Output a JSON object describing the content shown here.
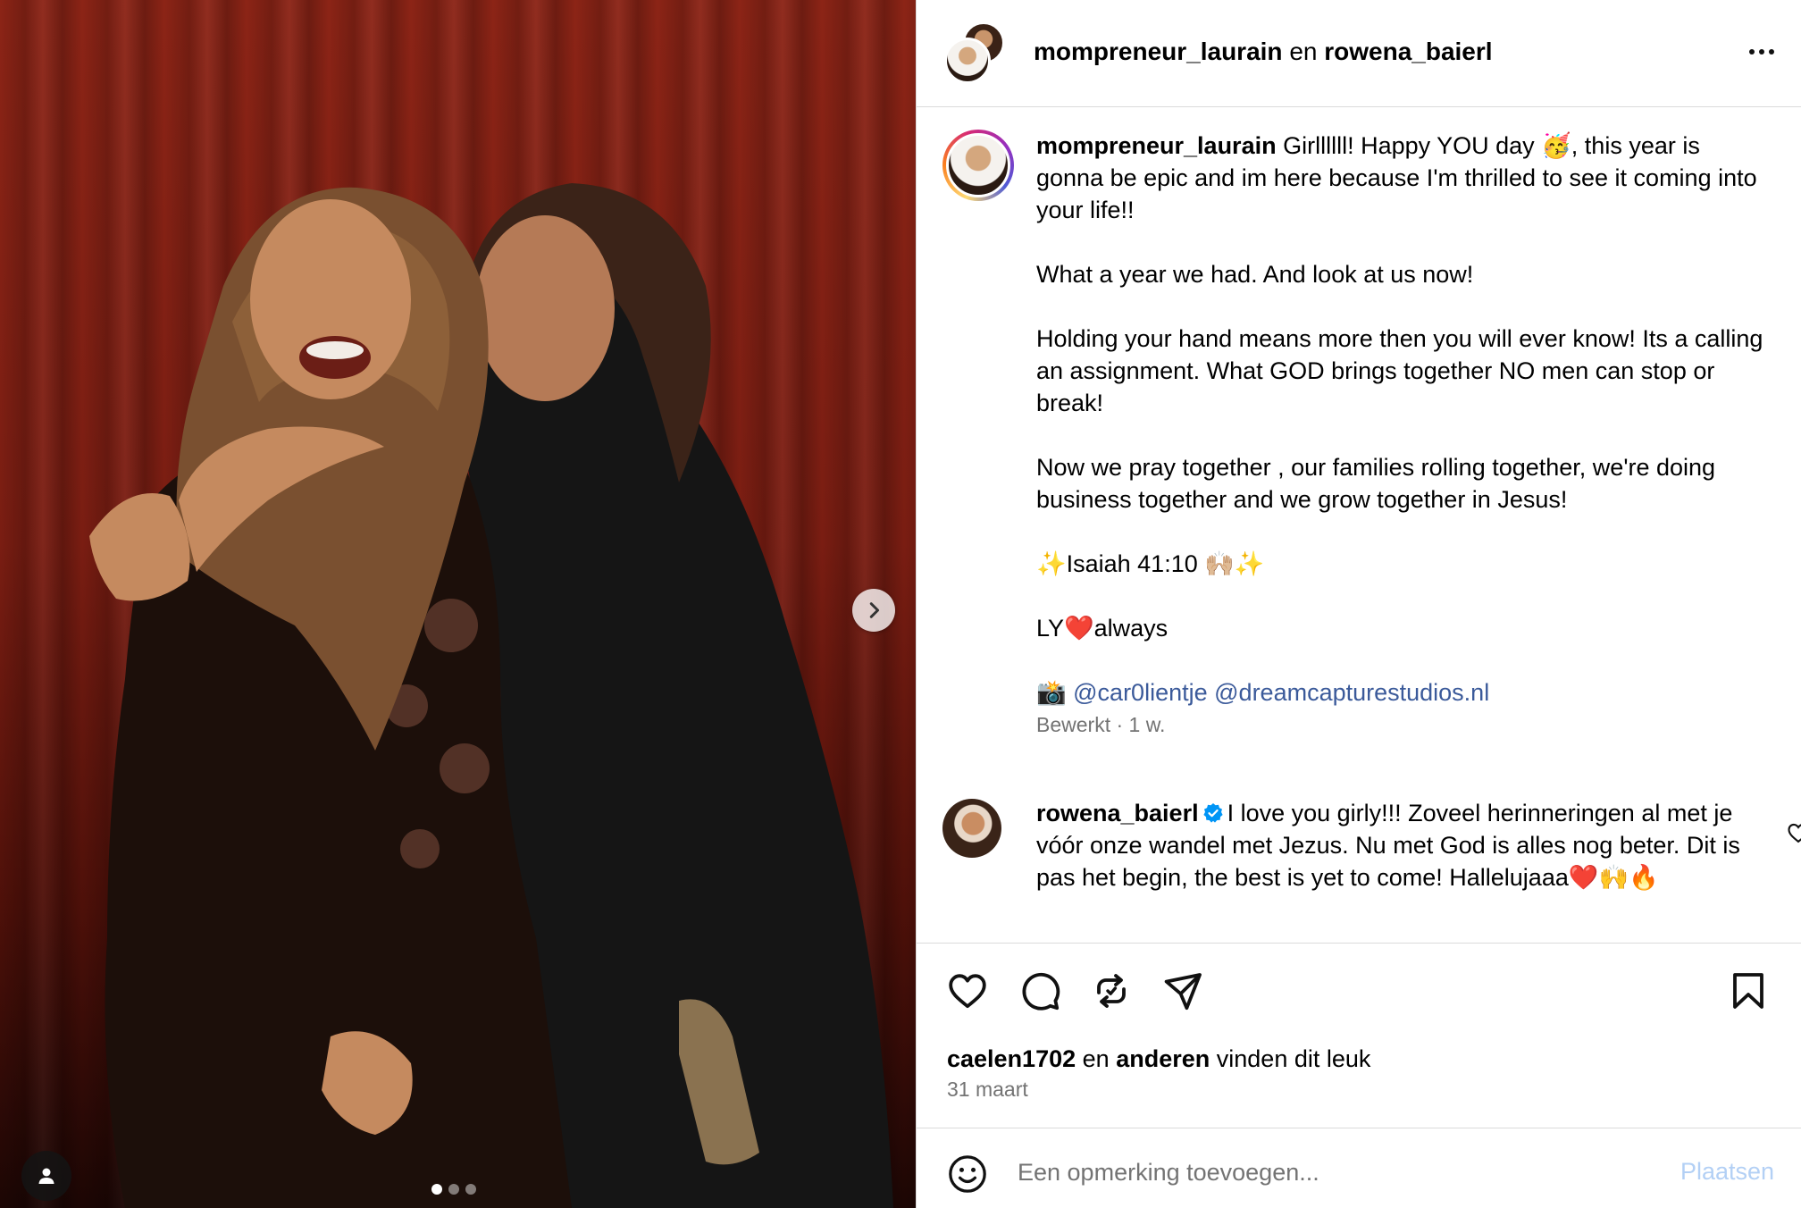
{
  "photo": {
    "alt_people": "photo-carousel",
    "carousel_dots": 3,
    "active_dot": 0,
    "next_icon": "chevron-right-icon",
    "user_tag_icon": "person-icon"
  },
  "header": {
    "user1": "mompreneur_laurain",
    "joiner": "en",
    "user2": "rowena_baierl",
    "more_icon": "more-horizontal-icon"
  },
  "caption": {
    "username": "mompreneur_laurain",
    "line1": "Girllllll! Happy YOU day 🥳, this year is gonna be epic and im here because I'm thrilled to see it coming into your life!!",
    "line2": "What a year we had. And look at us now!",
    "line3": "Holding your hand means more then you will ever know! Its a calling an assignment. What GOD brings together NO men can stop or break!",
    "line4": "Now we pray together , our families rolling together, we're doing business together and we grow together in Jesus!",
    "line5": "✨Isaiah 41:10 🙌🏼✨",
    "line6": "LY❤️always",
    "camera": "📸",
    "mention1": "@car0lientje",
    "mention2": "@dreamcapturestudios.nl",
    "meta": "Bewerkt · 1 w."
  },
  "comment": {
    "username": "rowena_baierl",
    "text": "I love you girly!!! Zoveel herinneringen al met je vóór onze wandel met Jezus. Nu met God is alles nog beter. Dit is pas het begin, the best is yet to come! Hallelujaaa❤️🙌🔥",
    "verified_icon": "verified-badge-icon",
    "like_icon": "heart-outline-icon"
  },
  "actions": {
    "like_icon": "heart-icon",
    "comment_icon": "comment-icon",
    "repost_icon": "repost-icon",
    "share_icon": "send-icon",
    "save_icon": "bookmark-icon"
  },
  "likes": {
    "user": "caelen1702",
    "joiner": "en",
    "others": "anderen",
    "suffix": "vinden dit leuk"
  },
  "date": "31 maart",
  "add_comment": {
    "placeholder": "Een opmerking toevoegen...",
    "post_label": "Plaatsen",
    "emoji_icon": "emoji-icon",
    "accent_color": "#0095f6"
  }
}
